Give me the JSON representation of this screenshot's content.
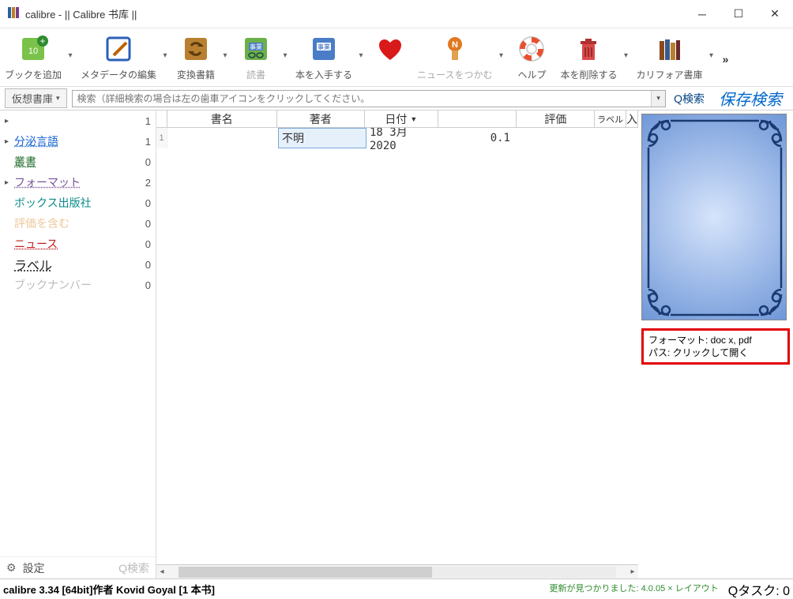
{
  "window": {
    "title": "calibre - || Calibre 书库 ||"
  },
  "toolbar": {
    "add": "ブックを追加",
    "metadata": "メタデータの編集",
    "convert": "変換書籍",
    "read": "読書",
    "get": "本を入手する",
    "news": "ニュースをつかむ",
    "help": "ヘルプ",
    "delete": "本を削除する",
    "library": "カリフォア書庫",
    "read_icon_text": "事業"
  },
  "searchrow": {
    "virtual_library": "仮想書庫",
    "placeholder": "検索（詳細検索の場合は左の歯車アイコンをクリックしてください。",
    "qsearch": "Q検索",
    "saved": "保存検索"
  },
  "sidebar": {
    "items": [
      {
        "label": "",
        "count": "1"
      },
      {
        "label": "分泌言語",
        "count": "1"
      },
      {
        "label": "叢書",
        "count": "0"
      },
      {
        "label": "フォーマット",
        "count": "2"
      },
      {
        "label": "ボックス出版社",
        "count": "0"
      },
      {
        "label": "評価を含む",
        "count": "0"
      },
      {
        "label": "ニュース",
        "count": "0"
      },
      {
        "label": "ラベル",
        "count": "0"
      },
      {
        "label": "ブックナンバー",
        "count": "0"
      }
    ],
    "settings": "設定",
    "qsearch": "Q検索"
  },
  "table": {
    "headers": {
      "title": "書名",
      "author": "著者",
      "date": "日付",
      "rating": "評価",
      "label": "ラベル",
      "rest": "入"
    },
    "rows": [
      {
        "rownum": "1",
        "title": "",
        "author": "不明",
        "date": "18 3月 2020",
        "size": "0.1"
      }
    ]
  },
  "details": {
    "formats_label": "フォーマット: ",
    "formats_value": "doc x, pdf",
    "path_label": "パス: ",
    "path_value": "クリックして開く"
  },
  "statusbar": {
    "left": "calibre 3.34 [64bit]作者 Kovid Goyal   [1 本书]",
    "update": "更新が見つかりました: 4.0.05 × レイアウト",
    "tasks": "Qタスク: 0"
  }
}
